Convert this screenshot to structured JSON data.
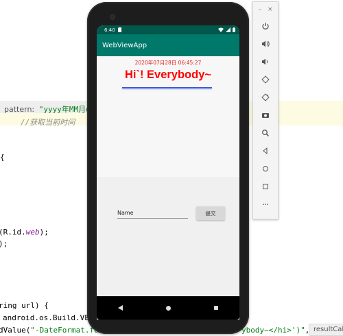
{
  "editor": {
    "hint_label": "pattern:",
    "hint_string": "\"yyyy年MM月dd",
    "comment_line": "//获取当前时间",
    "brace1": "{",
    "find_view_prefix": "(R.id.",
    "find_view_field": "web",
    "find_view_suffix": ");",
    "close_paren": ");",
    "method_sig": "ring url) {",
    "build_line": "android.os.Build.VERSI",
    "eval_prefix": "dValue(",
    "eval_string_a": "\"-DateFormat.fo",
    "eval_string_b": "ybody~</hi>')\"",
    "eval_suffix": ",",
    "result_label": "resultCall"
  },
  "toolbar": {
    "minimize": "–",
    "close": "×",
    "buttons": [
      "power-icon",
      "volume-up-icon",
      "volume-down-icon",
      "rotate-left-icon",
      "rotate-right-icon",
      "camera-icon",
      "zoom-icon",
      "back-icon",
      "home-icon",
      "overview-icon",
      "more-icon"
    ]
  },
  "phone": {
    "status": {
      "time": "6:40"
    },
    "app_title": "WebViewApp",
    "webview": {
      "date": "2020年07月28日 06:45:27",
      "heading": "Hi`! Everybody~"
    },
    "form": {
      "name_label": "Name",
      "submit_label": "提交"
    }
  },
  "colors": {
    "statusbar": "#00574b",
    "appbar": "#00796b",
    "heading": "#ff0000",
    "underline": "#3b5bdb"
  }
}
